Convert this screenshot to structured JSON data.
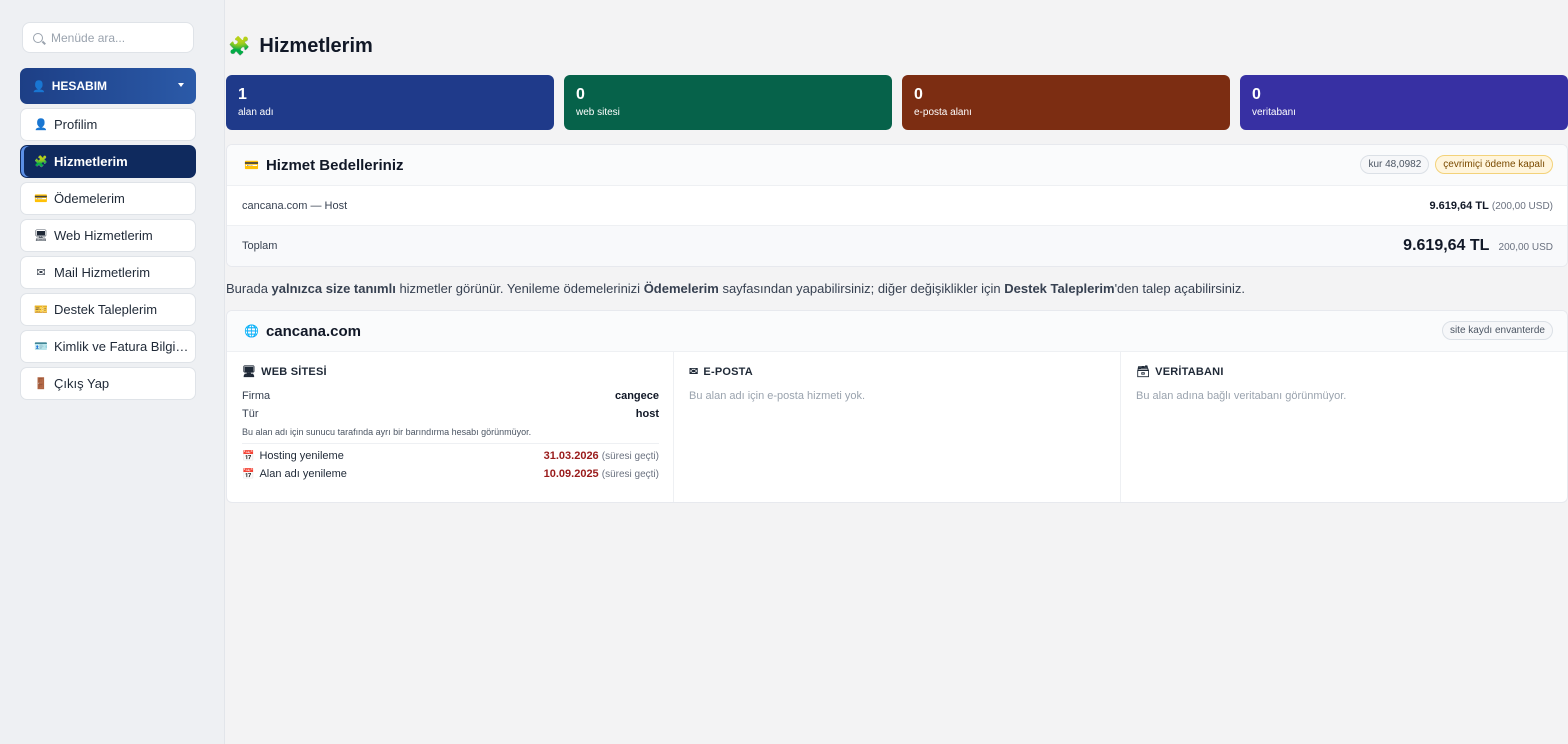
{
  "sidebar": {
    "search_placeholder": "Menüde ara...",
    "account_header": "HESABIM",
    "items": [
      {
        "label": "Profilim",
        "icon": "👤"
      },
      {
        "label": "Hizmetlerim",
        "icon": "🧩",
        "active": true
      },
      {
        "label": "Ödemelerim",
        "icon": "💳"
      },
      {
        "label": "Web Hizmetlerim",
        "icon": "🖥"
      },
      {
        "label": "Mail Hizmetlerim",
        "icon": "✉"
      },
      {
        "label": "Destek Taleplerim",
        "icon": "🎫"
      },
      {
        "label": "Kimlik ve Fatura Bilgileri",
        "icon": "🪪"
      },
      {
        "label": "Çıkış Yap",
        "icon": "🚪"
      }
    ]
  },
  "page": {
    "title": "Hizmetlerim",
    "title_icon": "🧩"
  },
  "stats": [
    {
      "value": "1",
      "label": "alan adı",
      "color": "#1f3a8a"
    },
    {
      "value": "0",
      "label": "web sitesi",
      "color": "#06624a"
    },
    {
      "value": "0",
      "label": "e-posta alanı",
      "color": "#7c2d12"
    },
    {
      "value": "0",
      "label": "veritabanı",
      "color": "#3730a3"
    }
  ],
  "billing": {
    "title": "Hizmet Bedelleriniz",
    "rate": "kur 48,0982",
    "online_status": "çevrimiçi ödeme kapalı",
    "line": {
      "name": "cancana.com — Host",
      "amount": "9.619,64 TL",
      "usd": "(200,00 USD)"
    },
    "total": {
      "label": "Toplam",
      "amount": "9.619,64 TL",
      "usd": "200,00 USD"
    }
  },
  "note": {
    "p1": "Burada ",
    "b1": "yalnızca size tanımlı",
    "p2": " hizmetler görünür. Yenileme ödemelerinizi ",
    "b2": "Ödemelerim",
    "p3": " sayfasından yapabilirsiniz; diğer değişiklikler için ",
    "b3": "Destek Taleplerim",
    "p4": "'den talep açabilirsiniz."
  },
  "domain": {
    "name": "cancana.com",
    "badge": "site kaydı envanterde",
    "web": {
      "title": "WEB SİTESİ",
      "firma_label": "Firma",
      "firma_value": "cangece",
      "tur_label": "Tür",
      "tur_value": "host",
      "note": "Bu alan adı için sunucu tarafında ayrı bir barındırma hesabı görünmüyor.",
      "renewals": [
        {
          "label": "Hosting yenileme",
          "date": "31.03.2026",
          "status": "(süresi geçti)"
        },
        {
          "label": "Alan adı yenileme",
          "date": "10.09.2025",
          "status": "(süresi geçti)"
        }
      ]
    },
    "email": {
      "title": "E-POSTA",
      "empty": "Bu alan adı için e-posta hizmeti yok."
    },
    "db": {
      "title": "VERİTABANI",
      "empty": "Bu alan adına bağlı veritabanı görünmüyor."
    }
  }
}
